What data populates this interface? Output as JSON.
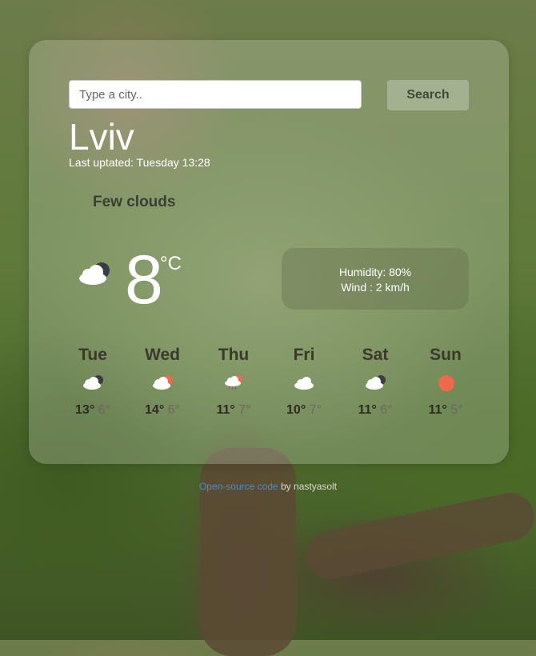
{
  "search": {
    "placeholder": "Type a city..",
    "button_label": "Search"
  },
  "current": {
    "city": "Lviv",
    "updated": "Last uptated: Tuesday 13:28",
    "description": "Few clouds",
    "icon": "few-clouds-night-icon",
    "temperature": "8",
    "unit": "°C",
    "humidity": "Humidity: 80%",
    "wind": "Wind : 2 km/h"
  },
  "forecast": [
    {
      "day": "Tue",
      "icon": "few-clouds-night-icon",
      "max": "13°",
      "min": "6°"
    },
    {
      "day": "Wed",
      "icon": "few-clouds-day-icon",
      "max": "14°",
      "min": "6°"
    },
    {
      "day": "Thu",
      "icon": "rain-day-icon",
      "max": "11°",
      "min": "7°"
    },
    {
      "day": "Fri",
      "icon": "cloud-icon",
      "max": "10°",
      "min": "7°"
    },
    {
      "day": "Sat",
      "icon": "few-clouds-night-icon",
      "max": "11°",
      "min": "6°"
    },
    {
      "day": "Sun",
      "icon": "sun-icon",
      "max": "11°",
      "min": "5°"
    }
  ],
  "footer": {
    "link_text": "Open-source code",
    "by_text": " by nastyasolt"
  },
  "colors": {
    "sun": "#ef6a4c",
    "link": "#4a8ec7",
    "cloud": "#ffffff",
    "night_cloud": "#3b3b44"
  }
}
